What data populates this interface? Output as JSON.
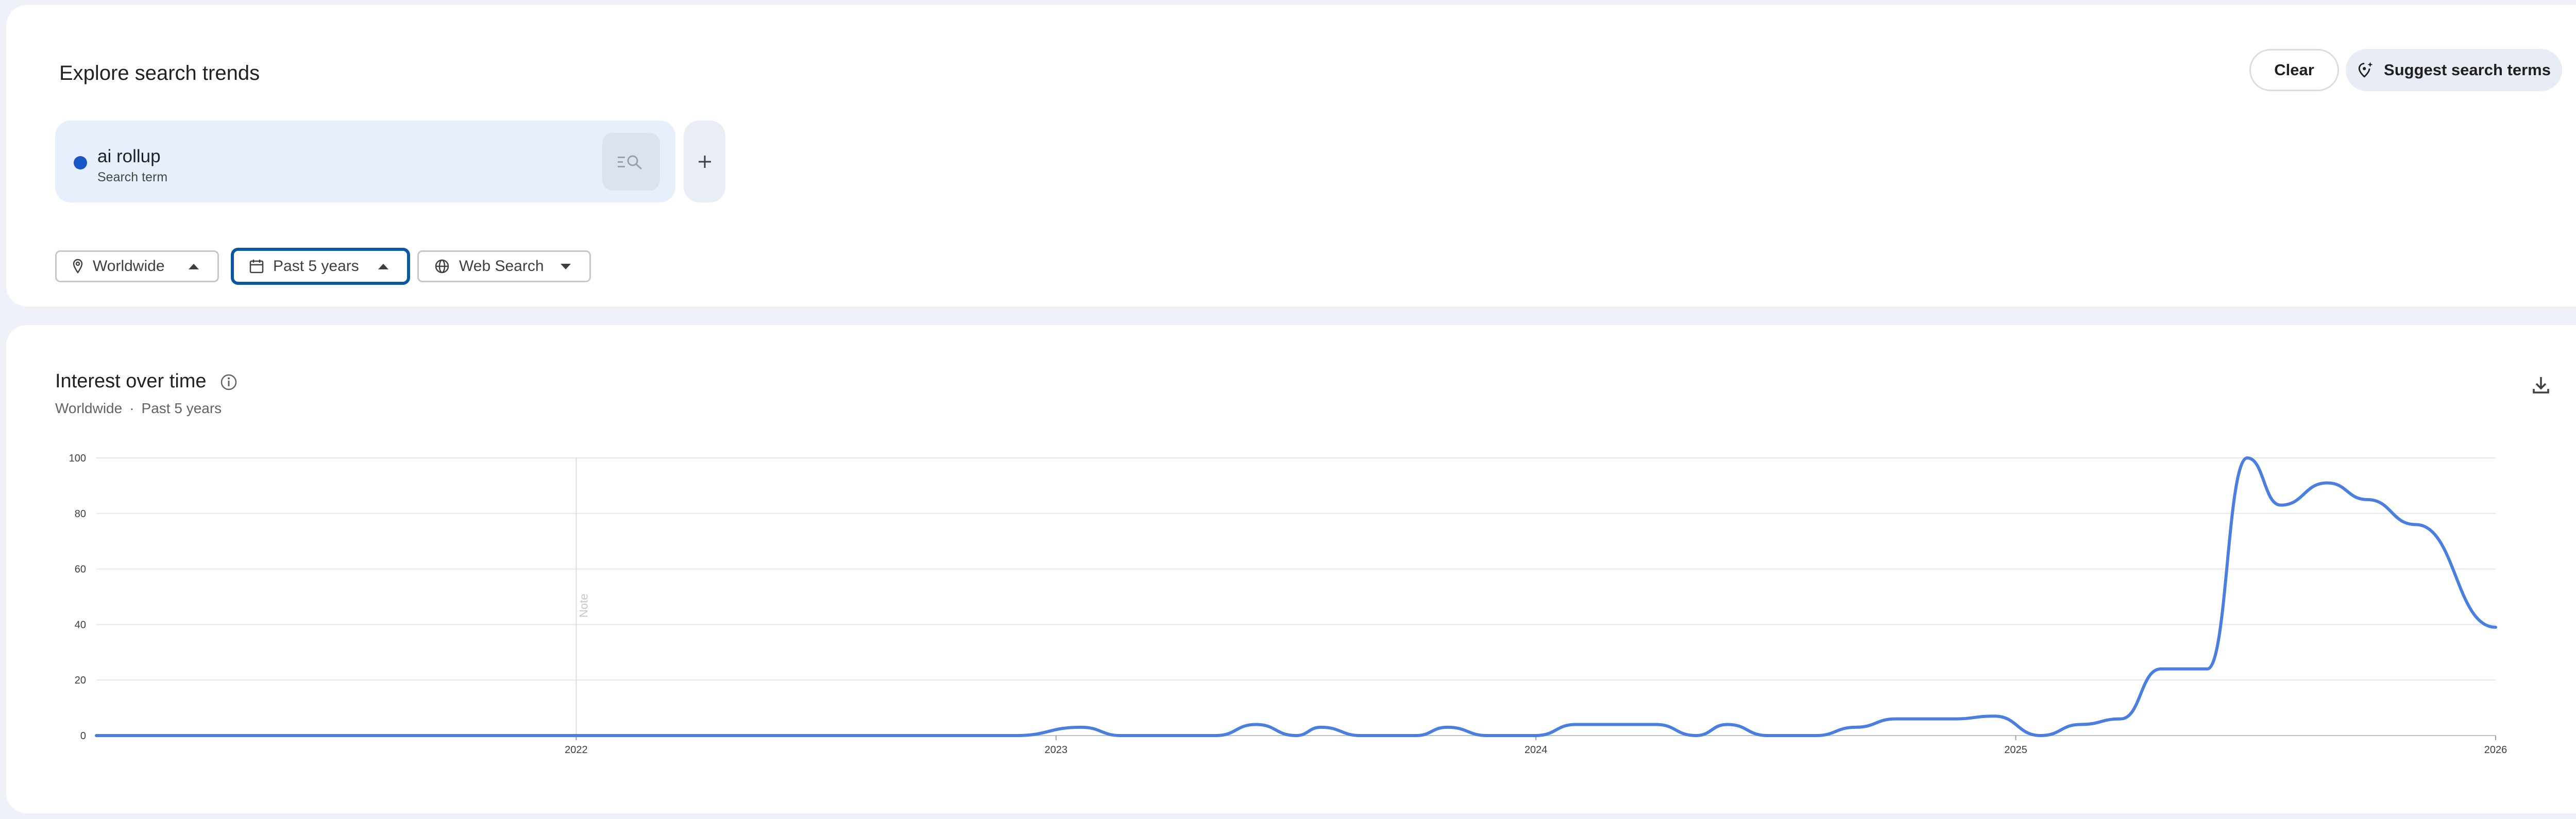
{
  "header": {
    "title": "Explore search trends",
    "clear_label": "Clear",
    "suggest_label": "Suggest search terms"
  },
  "search_term": {
    "name": "ai rollup",
    "type": "Search term",
    "color": "#1a56c8"
  },
  "filters": {
    "location": "Worldwide",
    "time_range": "Past 5 years",
    "property": "Web Search"
  },
  "chart": {
    "title": "Interest over time",
    "subtitle_location": "Worldwide",
    "subtitle_separator": "·",
    "subtitle_time": "Past 5 years",
    "note_label": "Note"
  },
  "chart_data": {
    "type": "line",
    "title": "Interest over time",
    "x_tick_labels": [
      "2022",
      "2023",
      "2024",
      "2025",
      "2026"
    ],
    "y_tick_labels": [
      "0",
      "20",
      "40",
      "60",
      "80",
      "100"
    ],
    "ylim": [
      0,
      100
    ],
    "xlim": [
      "2021-01",
      "2026-01"
    ],
    "grid": true,
    "note_marker_x": "2022-01",
    "series": [
      {
        "name": "ai rollup",
        "color": "#4a7fe0",
        "points": [
          [
            "2021-01",
            0
          ],
          [
            "2022-01",
            0
          ],
          [
            "2022-12",
            0
          ],
          [
            "2023-01-20",
            3
          ],
          [
            "2023-02-20",
            0
          ],
          [
            "2023-05",
            0
          ],
          [
            "2023-06-01",
            4
          ],
          [
            "2023-07-01",
            0
          ],
          [
            "2023-07-20",
            3
          ],
          [
            "2023-08-20",
            0
          ],
          [
            "2023-10",
            0
          ],
          [
            "2023-10-25",
            3
          ],
          [
            "2023-11-25",
            0
          ],
          [
            "2024-01",
            0
          ],
          [
            "2024-02",
            4
          ],
          [
            "2024-04",
            4
          ],
          [
            "2024-05",
            0
          ],
          [
            "2024-05-25",
            4
          ],
          [
            "2024-06-25",
            0
          ],
          [
            "2024-08",
            0
          ],
          [
            "2024-09-01",
            3
          ],
          [
            "2024-10-01",
            6
          ],
          [
            "2024-11-15",
            6
          ],
          [
            "2024-12-15",
            7
          ],
          [
            "2025-01-20",
            0
          ],
          [
            "2025-02-20",
            4
          ],
          [
            "2025-03-20",
            6
          ],
          [
            "2025-04-20",
            24
          ],
          [
            "2025-05-25",
            24
          ],
          [
            "2025-06-25",
            100
          ],
          [
            "2025-07-20",
            83
          ],
          [
            "2025-08-25",
            91
          ],
          [
            "2025-09-25",
            85
          ],
          [
            "2025-11",
            76
          ],
          [
            "2026-01",
            39
          ]
        ]
      }
    ]
  }
}
